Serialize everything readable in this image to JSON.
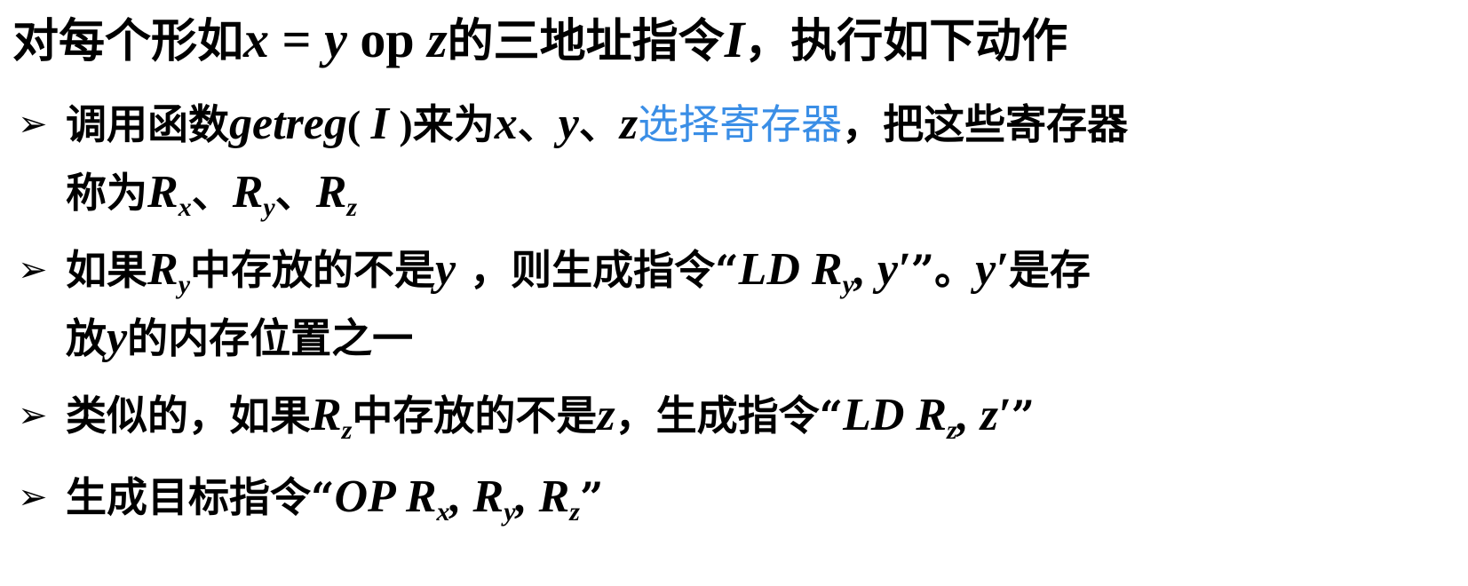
{
  "heading": {
    "prefix": "对每个形如",
    "x": "x",
    "eq": " = ",
    "y": "y",
    "op": " op ",
    "z": "z",
    "middle": "的三地址指令",
    "I": "I",
    "suffix": "，执行如下动作"
  },
  "bullets": [
    {
      "line1": {
        "t1": "调用函数",
        "fn": "getreg",
        "paren_open": "( ",
        "I": "I",
        "paren_close": " )",
        "t2": "来为",
        "x": "x",
        "sep1": "、",
        "y": "y",
        "sep2": "、",
        "z": "z",
        "highlight": "选择寄存器",
        "t3": "，把这些寄存器"
      },
      "line2": {
        "t1": "称为",
        "R1": "R",
        "s1": "x",
        "sep1": "、",
        "R2": "R",
        "s2": "y",
        "sep2": "、",
        "R3": "R",
        "s3": "z"
      }
    },
    {
      "line1": {
        "t1": "如果",
        "R": "R",
        "s": "y",
        "t2": "中存放的不是",
        "y": "y",
        "t3": " ，则生成指令“",
        "code_ld": "LD R",
        "code_s": "y",
        "code_rest": ", y′",
        "t4": "”。",
        "yp": "y′",
        "t5": "是存"
      },
      "line2": {
        "t1": "放",
        "y": "y",
        "t2": "的内存位置之一"
      }
    },
    {
      "line1": {
        "t1": "类似的，如果",
        "R": "R",
        "s": "z",
        "t2": "中存放的不是",
        "z": "z",
        "t3": "，生成指令“",
        "code_ld": "LD R",
        "code_s": "z",
        "code_rest": ",  z′",
        "t4": "”"
      }
    },
    {
      "line1": {
        "t1": "生成目标指令“",
        "code_op": "OP R",
        "s1": "x",
        "c1": ", R",
        "s2": "y",
        "c2": ", R",
        "s3": "z",
        "t2": "”"
      }
    }
  ],
  "bullet_symbol": "➢",
  "colors": {
    "text": "#000000",
    "highlight": "#3a8ee6",
    "background": "#ffffff"
  }
}
